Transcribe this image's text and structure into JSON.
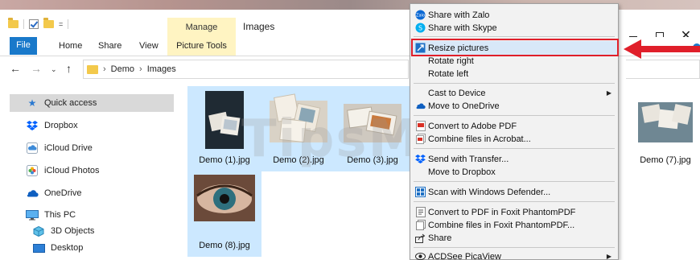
{
  "window": {
    "title": "Images",
    "manage_label": "Manage",
    "quick_access_dropdown": "="
  },
  "ribbon": {
    "tabs": [
      {
        "label": "File"
      },
      {
        "label": "Home"
      },
      {
        "label": "Share"
      },
      {
        "label": "View"
      },
      {
        "label": "Picture Tools"
      }
    ]
  },
  "address": {
    "crumbs": [
      "Demo",
      "Images"
    ]
  },
  "navigation": {
    "items": [
      {
        "label": "Quick access",
        "icon": "star-icon"
      },
      {
        "label": "Dropbox",
        "icon": "dropbox-icon"
      },
      {
        "label": "iCloud Drive",
        "icon": "icloud-drive-icon"
      },
      {
        "label": "iCloud Photos",
        "icon": "icloud-photos-icon"
      },
      {
        "label": "OneDrive",
        "icon": "onedrive-icon"
      },
      {
        "label": "This PC",
        "icon": "pc-icon"
      },
      {
        "label": "3D Objects",
        "icon": "3d-objects-icon"
      },
      {
        "label": "Desktop",
        "icon": "desktop-icon"
      }
    ]
  },
  "files": [
    {
      "name": "Demo (1).jpg"
    },
    {
      "name": "Demo (2).jpg"
    },
    {
      "name": "Demo (3).jpg"
    },
    {
      "name": "Demo (7).jpg"
    },
    {
      "name": "Demo (8).jpg"
    }
  ],
  "context_menu": {
    "items": [
      {
        "label": "Share with Zalo",
        "icon": "zalo-icon"
      },
      {
        "label": "Share with Skype",
        "icon": "skype-icon"
      },
      {
        "label": "Resize pictures",
        "icon": "resize-icon"
      },
      {
        "label": "Rotate right",
        "icon": ""
      },
      {
        "label": "Rotate left",
        "icon": ""
      },
      {
        "label": "Cast to Device",
        "icon": "",
        "submenu": true
      },
      {
        "label": "Move to OneDrive",
        "icon": "onedrive-icon"
      },
      {
        "label": "Convert to Adobe PDF",
        "icon": "adobe-pdf-icon"
      },
      {
        "label": "Combine files in Acrobat...",
        "icon": "acrobat-combine-icon"
      },
      {
        "label": "Send with Transfer...",
        "icon": "dropbox-transfer-icon"
      },
      {
        "label": "Move to Dropbox",
        "icon": ""
      },
      {
        "label": "Scan with Windows Defender...",
        "icon": "defender-icon"
      },
      {
        "label": "Convert to PDF in Foxit PhantomPDF",
        "icon": "foxit-convert-icon"
      },
      {
        "label": "Combine files in Foxit PhantomPDF...",
        "icon": "foxit-combine-icon"
      },
      {
        "label": "Share",
        "icon": "share-icon"
      },
      {
        "label": "ACDSee PicaView",
        "icon": "acdsee-icon",
        "submenu": true
      }
    ]
  },
  "watermark": "TipsMake",
  "colors": {
    "accent": "#1979ca",
    "picture_tools_bg": "#fff4c2",
    "selection": "#cce8ff",
    "highlight_border": "#e01f2a"
  }
}
